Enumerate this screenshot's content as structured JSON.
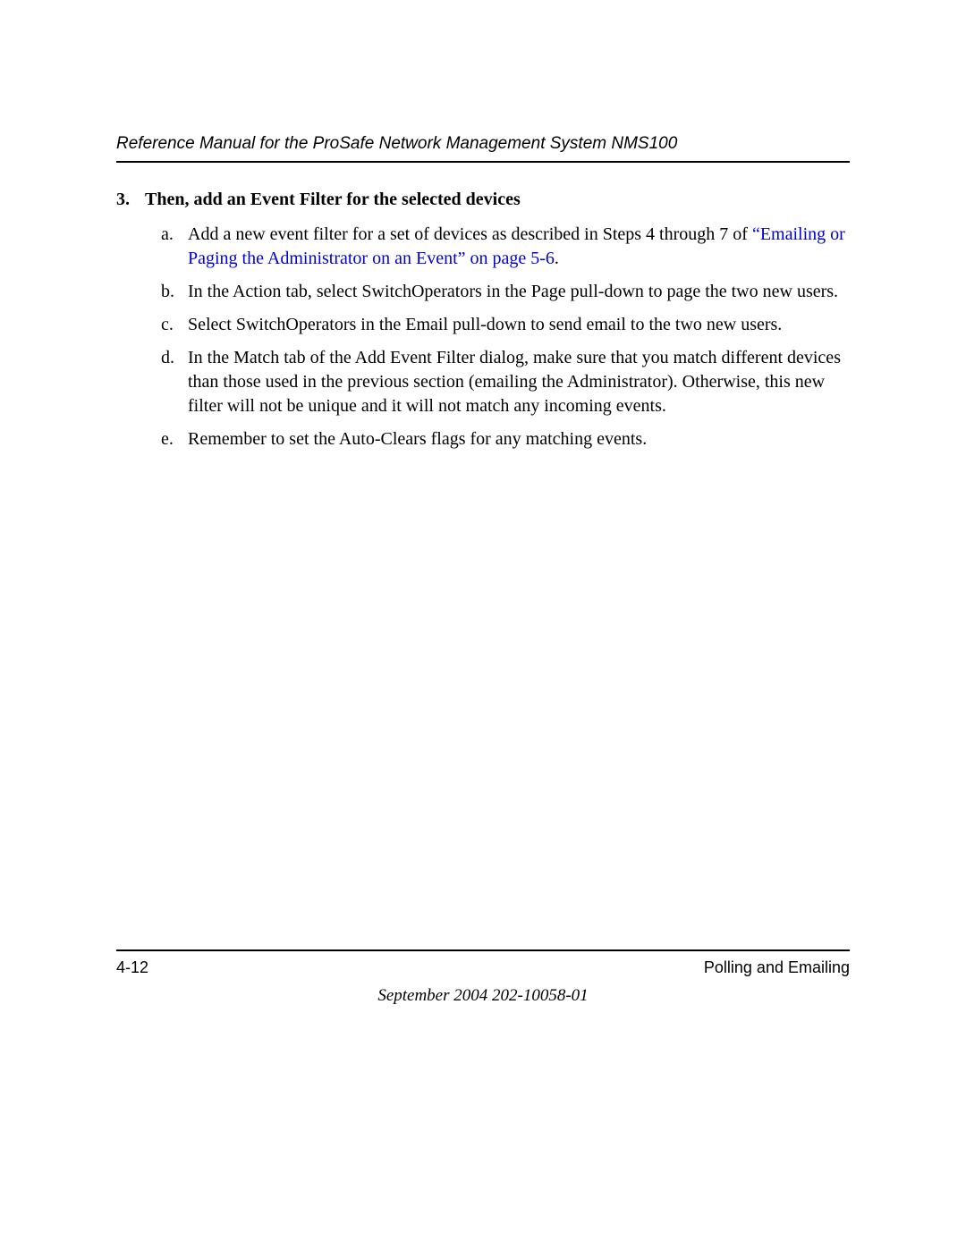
{
  "header": {
    "title": "Reference Manual for the ProSafe Network Management System NMS100"
  },
  "step": {
    "number": "3.",
    "title": "Then, add an Event Filter for the selected devices"
  },
  "items": {
    "a": {
      "letter": "a.",
      "text_before": "Add a new event filter for a set of devices as described in Steps 4 through 7 of ",
      "link": "“Emailing or Paging the Administrator on an Event” on page 5-6",
      "text_after": "."
    },
    "b": {
      "letter": "b.",
      "text": "In the Action tab, select SwitchOperators in the Page pull-down to page the two new users."
    },
    "c": {
      "letter": "c.",
      "text": "Select SwitchOperators in the Email pull-down to send email to the two new users."
    },
    "d": {
      "letter": "d.",
      "text": "In the Match tab of the Add Event Filter dialog, make sure that you match different devices than those used in the previous section (emailing the Administrator). Otherwise, this new filter will not be unique and it will not match any incoming events."
    },
    "e": {
      "letter": "e.",
      "text": "Remember to set the Auto-Clears flags for any matching events."
    }
  },
  "footer": {
    "page_num": "4-12",
    "section": "Polling and Emailing",
    "date": "September 2004 202-10058-01"
  }
}
